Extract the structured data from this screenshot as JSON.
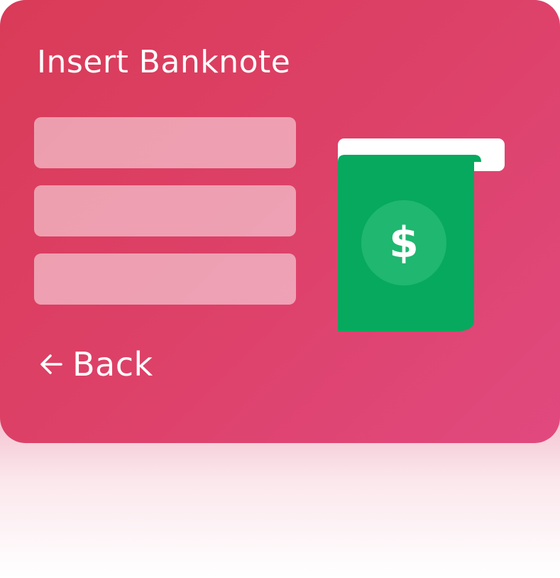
{
  "screen": {
    "title": "Insert Banknote",
    "fields": [
      {
        "value": ""
      },
      {
        "value": ""
      },
      {
        "value": ""
      }
    ],
    "banknote_icon": "dollar-banknote-icon",
    "banknote_symbol": "$",
    "back": {
      "icon": "arrow-left-icon",
      "label": "Back"
    }
  },
  "colors": {
    "card_start": "#d93b57",
    "card_end": "#e1497f",
    "banknote_green": "#06a95e",
    "coin_green": "#20b770",
    "text": "#ffffff"
  }
}
